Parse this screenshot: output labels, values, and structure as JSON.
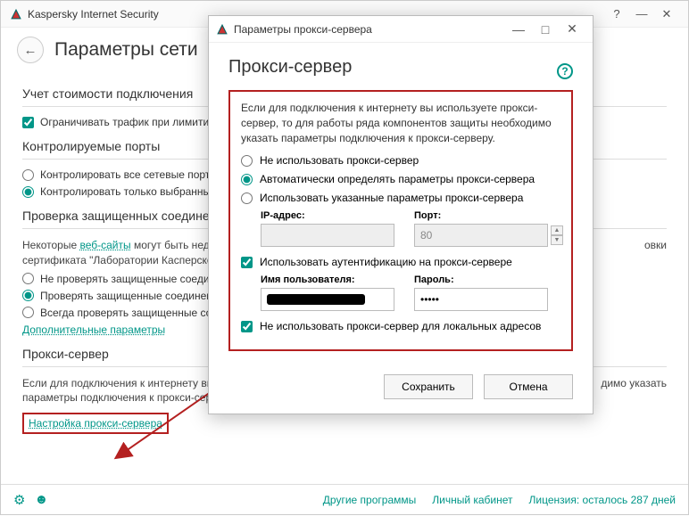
{
  "main": {
    "app_title": "Kaspersky Internet Security",
    "page_title": "Параметры сети",
    "sections": {
      "cost": {
        "title": "Учет стоимости подключения",
        "limit_traffic": "Ограничивать трафик при лимитированном подключении"
      },
      "ports": {
        "title": "Контролируемые порты",
        "opt_all": "Контролировать все сетевые порты",
        "opt_selected": "Контролировать только выбранные порты"
      },
      "ssl": {
        "title": "Проверка защищенных соединений",
        "desc_prefix": "Некоторые ",
        "desc_link": "веб-сайты",
        "desc_mid": " могут быть недоступны",
        "desc_line2": "сертификата \"Лаборатории Касперского\"",
        "desc_suffix": "овки",
        "opt_no": "Не проверять защищенные соединения",
        "opt_yes": "Проверять защищенные соединения",
        "opt_always": "Всегда проверять защищенные соединения",
        "extra_link": "Дополнительные параметры"
      },
      "proxy": {
        "title": "Прокси-сервер",
        "desc1": "Если для подключения к интернету вы",
        "desc2": "параметры подключения к прокси-серверу",
        "desc_suffix": "димо указать",
        "link": "Настройка прокси-сервера"
      }
    },
    "footer": {
      "link1": "Другие программы",
      "link2": "Личный кабинет",
      "link3": "Лицензия: осталось 287 дней"
    }
  },
  "dialog": {
    "title": "Параметры прокси-сервера",
    "heading": "Прокси-сервер",
    "intro": "Если для подключения к интернету вы используете прокси-сервер, то для работы ряда компонентов защиты необходимо указать параметры подключения к прокси-серверу.",
    "opt_none": "Не использовать прокси-сервер",
    "opt_auto": "Автоматически определять параметры прокси-сервера",
    "opt_manual": "Использовать указанные параметры прокси-сервера",
    "ip_label": "IP-адрес:",
    "port_label": "Порт:",
    "port_value": "80",
    "auth_check": "Использовать аутентификацию на прокси-сервере",
    "user_label": "Имя пользователя:",
    "pass_label": "Пароль:",
    "pass_value": "•••••",
    "bypass_local": "Не использовать прокси-сервер для локальных адресов",
    "save": "Сохранить",
    "cancel": "Отмена"
  }
}
